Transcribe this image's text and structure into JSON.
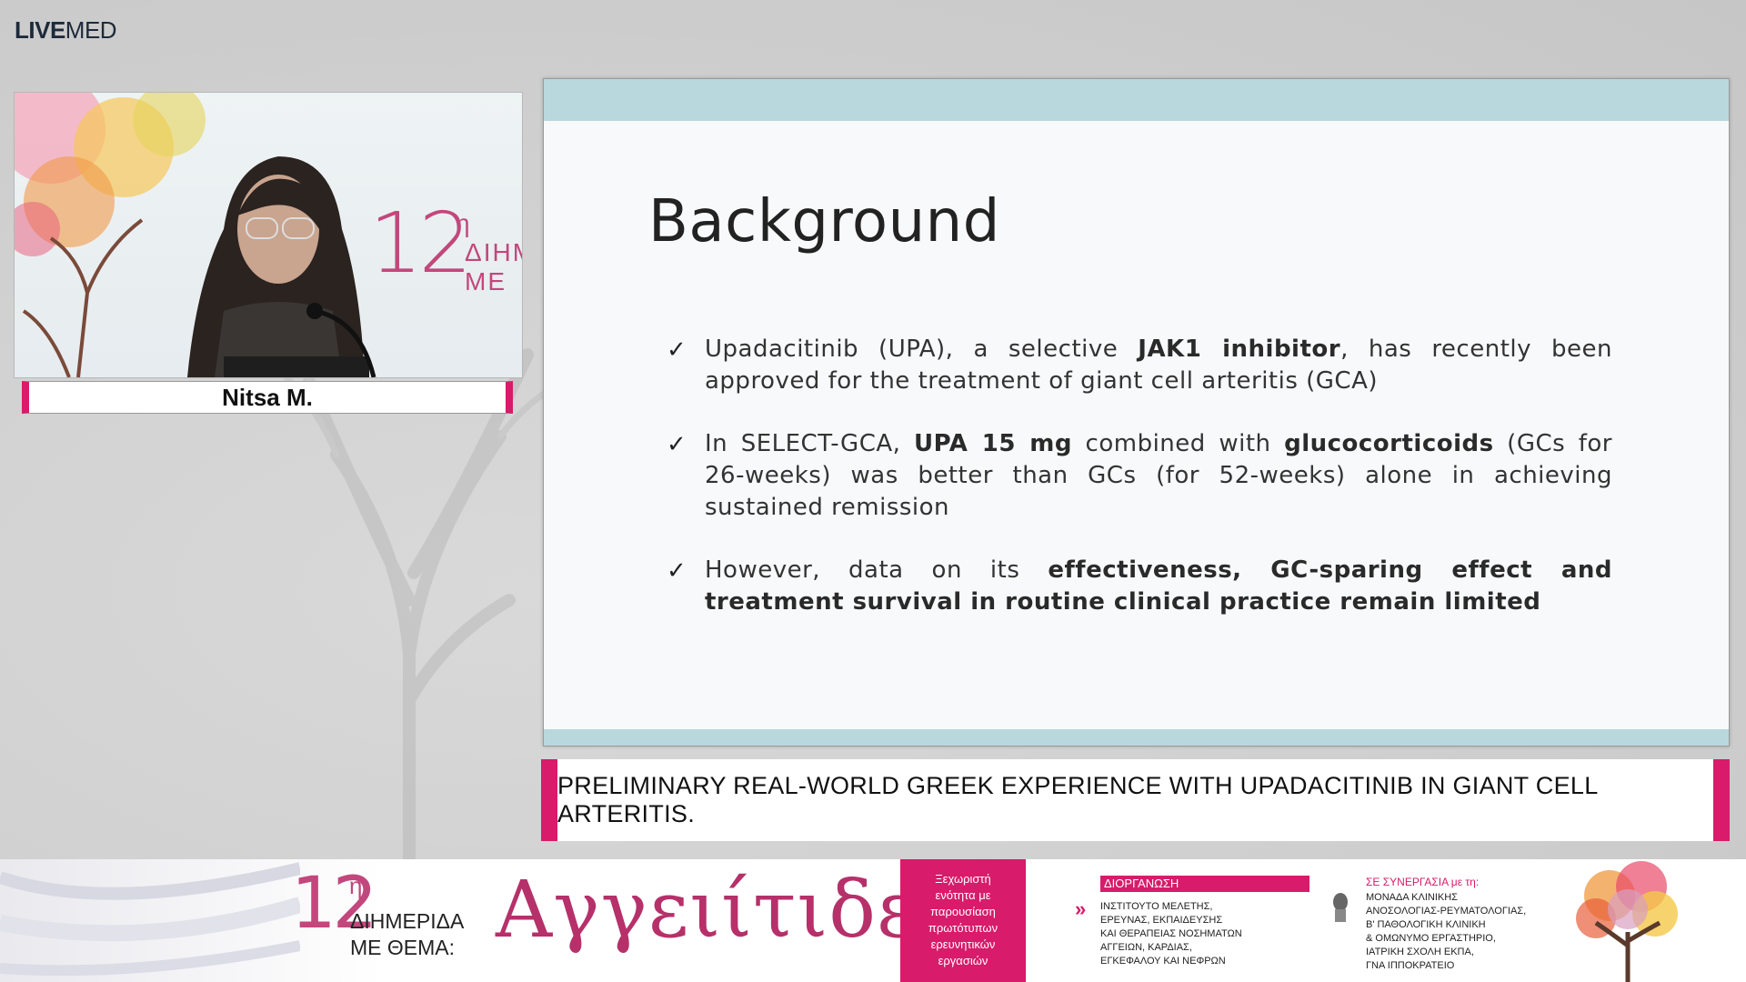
{
  "logo": {
    "bold": "LIVE",
    "regular": "MED"
  },
  "video": {
    "event_number": "12",
    "event_sup": "η",
    "event_line1": "ΔΙΗΜ",
    "event_line2": "ΜΕ"
  },
  "speaker": {
    "name": "Nitsa M."
  },
  "slide": {
    "title": "Background",
    "bullets": [
      {
        "parts": [
          {
            "t": "Upadacitinib (UPA), a selective ",
            "b": false
          },
          {
            "t": "JAK1 inhibitor",
            "b": true
          },
          {
            "t": ", has recently been approved for the treatment of giant cell arteritis (GCA)",
            "b": false
          }
        ]
      },
      {
        "parts": [
          {
            "t": "In SELECT-GCA, ",
            "b": false
          },
          {
            "t": "UPA 15 mg",
            "b": true
          },
          {
            "t": " combined with ",
            "b": false
          },
          {
            "t": "glucocorticoids",
            "b": true
          },
          {
            "t": " (GCs for 26-weeks) was better than GCs (for 52-weeks) alone in achieving sustained remission",
            "b": false
          }
        ]
      },
      {
        "parts": [
          {
            "t": "However, data on its ",
            "b": false
          },
          {
            "t": "effectiveness, GC-sparing effect and treatment survival  in routine clinical practice remain limited",
            "b": true
          }
        ]
      }
    ],
    "check_symbol": "✓"
  },
  "talk_title": "PRELIMINARY REAL-WORLD GREEK EXPERIENCE WITH UPADACITINIB IN GIANT CELL ARTERITIS.",
  "footer": {
    "event_number": "12",
    "event_sup": "η",
    "event_sub1": "ΔΙΗΜΕΡΙΔΑ",
    "event_sub2": "ΜΕ ΘΕΜΑ:",
    "event_title": "Αγγειίτιδες",
    "pink_box_lines": [
      "Ξεχωριστή",
      "ενότητα με",
      "παρουσίαση",
      "πρωτότυπων",
      "ερευνητικών",
      "εργασιών"
    ],
    "org_label": "ΔΙΟΡΓΑΝΩΣΗ",
    "org_lines": [
      "ΙΝΣΤΙΤΟΥΤΟ ΜΕΛΕΤΗΣ,",
      "ΕΡΕΥΝΑΣ, ΕΚΠΑΙΔΕΥΣΗΣ",
      "ΚΑΙ ΘΕΡΑΠΕΙΑΣ ΝΟΣΗΜΑΤΩΝ",
      "ΑΓΓΕΙΩΝ, ΚΑΡΔΙΑΣ,",
      "ΕΓΚΕΦΑΛΟΥ ΚΑΙ ΝΕΦΡΩΝ"
    ],
    "syn_label": "ΣΕ ΣΥΝΕΡΓΑΣΙΑ",
    "syn_label_small": " με τη:",
    "syn_lines": [
      "ΜΟΝΑΔΑ ΚΛΙΝΙΚΗΣ",
      "ΑΝΟΣΟΛΟΓΙΑΣ-ΡΕΥΜΑΤΟΛΟΓΙΑΣ,",
      "Β' ΠΑΘΟΛΟΓΙΚΗ ΚΛΙΝΙΚΗ",
      "& ΟΜΩΝΥΜΟ ΕΡΓΑΣΤΗΡΙΟ,",
      "ΙΑΤΡΙΚΗ ΣΧΟΛΗ ΕΚΠΑ,",
      "ΓΝΑ ΙΠΠΟΚΡΑΤΕΙΟ"
    ]
  },
  "colors": {
    "accent": "#d81b6b",
    "event_pink": "#c2477c",
    "slide_band": "#b9d8de"
  }
}
